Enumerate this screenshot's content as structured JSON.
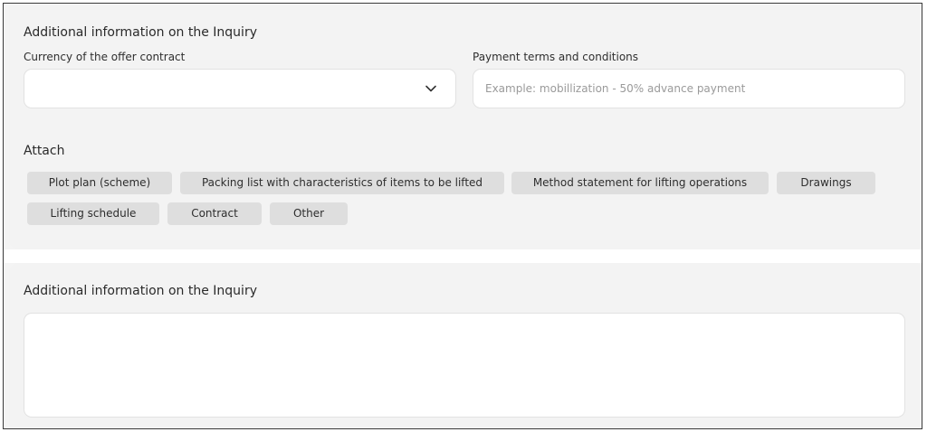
{
  "top_section": {
    "title": "Additional information on the Inquiry",
    "currency": {
      "label": "Currency of the offer contract",
      "value": ""
    },
    "payment": {
      "label": "Payment terms and conditions",
      "placeholder": "Example: mobillization - 50% advance payment",
      "value": ""
    }
  },
  "attach": {
    "title": "Attach",
    "chips": [
      "Plot plan (scheme)",
      "Packing list with characteristics of items to be lifted",
      "Method statement for lifting operations",
      "Drawings",
      "Lifting schedule",
      "Contract",
      "Other"
    ]
  },
  "bottom_section": {
    "title": "Additional information on the Inquiry",
    "value": ""
  },
  "icons": {
    "dropdown": "chevron-down-icon"
  },
  "colors": {
    "panel_bg": "#f3f3f3",
    "chip_bg": "#dedede",
    "field_bg": "#ffffff"
  }
}
